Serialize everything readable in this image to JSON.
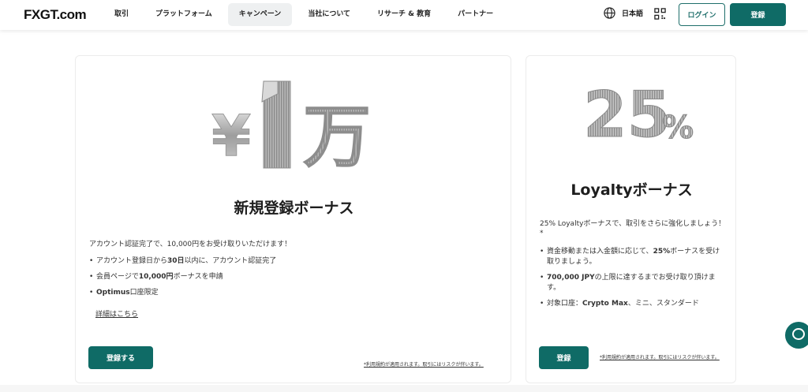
{
  "header": {
    "logo": "FXGT.com",
    "nav": [
      "取引",
      "プラットフォーム",
      "キャンペーン",
      "当社について",
      "リサーチ & 教育",
      "パートナー"
    ],
    "active_nav": "キャンペーン",
    "language": "日本語",
    "login_label": "ログイン",
    "register_label": "登録"
  },
  "cards": {
    "welcome": {
      "hero_text": "¥1万",
      "title": "新規登録ボーナス",
      "description": "アカウント認証完了で、10,000円をお受け取りいただけます！",
      "bullets": [
        {
          "pre": "アカウント登録日から",
          "bold": "30日",
          "post": "以内に、アカウント認証完了"
        },
        {
          "pre": "会員ページで",
          "bold": "10,000円",
          "post": "ボーナスを申請"
        },
        {
          "pre": "",
          "bold": "Optimus",
          "post": "口座限定"
        }
      ],
      "link_label": "詳細はこちら",
      "cta_label": "登録する",
      "terms": "*利用規約が適用されます。取引にはリスクが伴います。"
    },
    "loyalty": {
      "hero_text": "25%",
      "title": "Loyaltyボーナス",
      "description": "25% Loyaltyボーナスで、取引をさらに強化しましょう！*",
      "bullets": [
        {
          "pre": "資金移動または入金額に応じて、",
          "bold": "25%",
          "post": "ボーナスを受け取りましょう。"
        },
        {
          "pre": "",
          "bold": "700,000 JPY",
          "post": "の上限に達するまでお受け取り頂けます。"
        },
        {
          "pre": "対象口座：",
          "bold": "Crypto Max",
          "post": "、ミニ、スタンダード"
        }
      ],
      "cta_label": "登録",
      "terms": "*利用規約が適用されます。取引にはリスクが伴います。"
    }
  },
  "colors": {
    "primary": "#0f6b66",
    "nav_active_bg": "#eef0f1"
  },
  "icons": [
    "globe-icon",
    "qr-code-icon",
    "chat-icon"
  ]
}
